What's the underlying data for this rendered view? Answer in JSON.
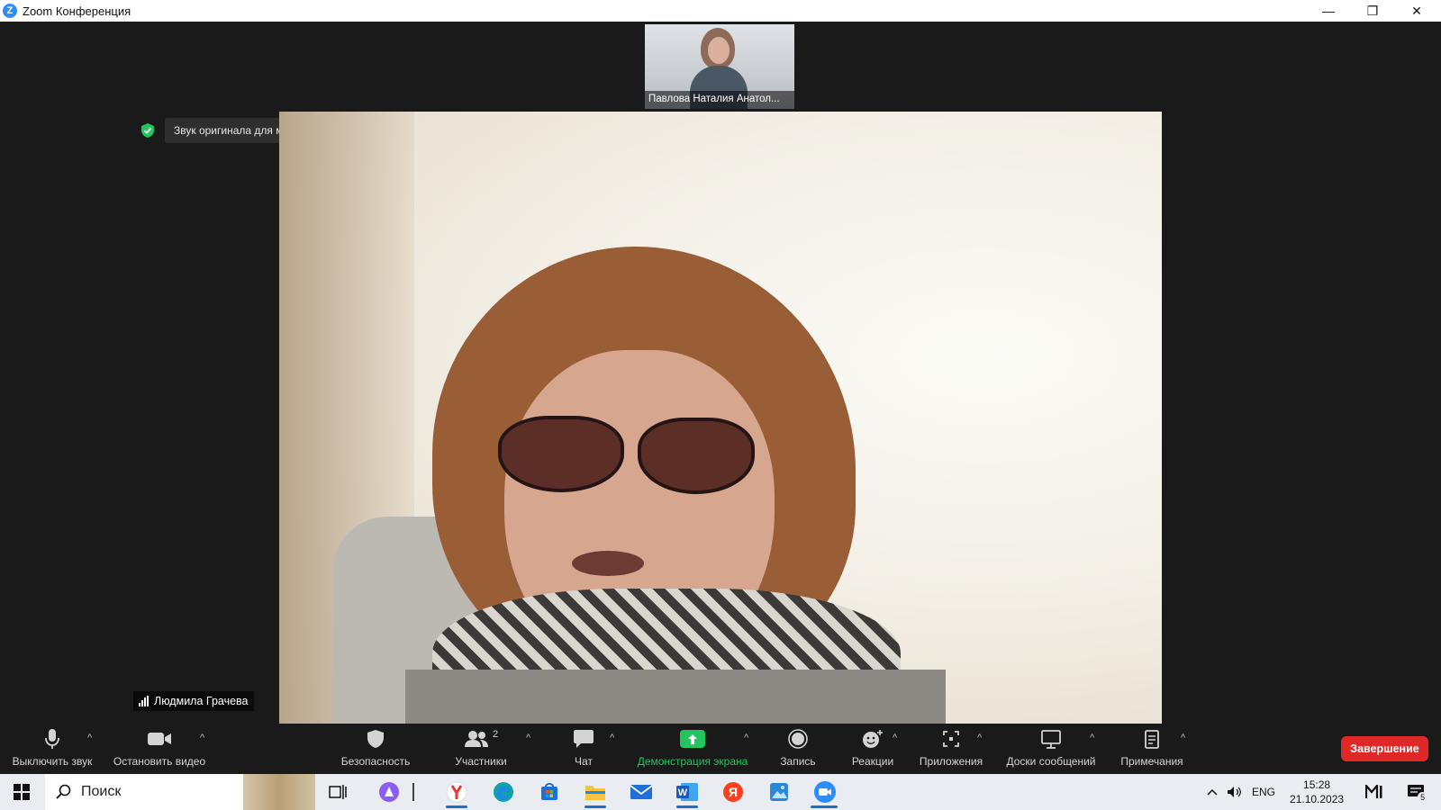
{
  "window": {
    "title": "Zoom Конференция",
    "minimize": "—",
    "restore": "❐",
    "close": "✕"
  },
  "meeting": {
    "thumbnail_name": "Павлова Наталия Анатол...",
    "audio_notice": "Звук оригинала для музыкантов выключен",
    "active_speaker": "Людмила Грачева"
  },
  "toolbar": {
    "mute": "Выключить звук",
    "video": "Остановить видео",
    "security": "Безопасность",
    "participants": "Участники",
    "participants_count": "2",
    "chat": "Чат",
    "share": "Демонстрация экрана",
    "record": "Запись",
    "reactions": "Реакции",
    "apps": "Приложения",
    "whiteboards": "Доски сообщений",
    "notes": "Примечания",
    "end": "Завершение",
    "caret": "^"
  },
  "taskbar": {
    "search": "Поиск",
    "language": "ENG",
    "time": "15:28",
    "date": "21.10.2023",
    "notification_count": "5"
  },
  "colors": {
    "share_green": "#22c55e",
    "end_red": "#e02828",
    "zoom_blue": "#2d8cff"
  }
}
